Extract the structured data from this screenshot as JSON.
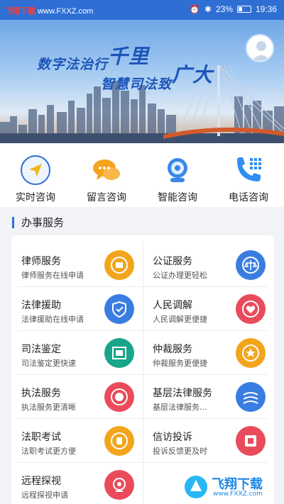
{
  "status_bar": {
    "watermark_prefix": "飞翔下载",
    "watermark_site": "www.FXXZ.com",
    "battery": "23%",
    "time": "19:36"
  },
  "banner": {
    "slogan_line1": "数字法治行",
    "slogan_line1_big": "千里",
    "slogan_line2": "智慧司法致",
    "slogan_line2_big": "广大"
  },
  "quick_actions": [
    {
      "label": "实时咨询",
      "icon": "send-icon"
    },
    {
      "label": "留言咨询",
      "icon": "chat-bubbles-icon"
    },
    {
      "label": "智能咨询",
      "icon": "robot-icon"
    },
    {
      "label": "电话咨询",
      "icon": "phone-icon"
    }
  ],
  "section": {
    "title": "办事服务"
  },
  "services": [
    {
      "title": "律师服务",
      "subtitle": "律师服务在线申请",
      "icon": "lawyer-badge-icon",
      "color": "#f2a51c"
    },
    {
      "title": "公证服务",
      "subtitle": "公证办理更轻松",
      "icon": "notary-scale-icon",
      "color": "#3a7de0"
    },
    {
      "title": "法律援助",
      "subtitle": "法律援助在线申请",
      "icon": "legal-aid-shield-icon",
      "color": "#3a7de0"
    },
    {
      "title": "人民调解",
      "subtitle": "人民调解更便捷",
      "icon": "mediation-heart-icon",
      "color": "#e94b5b"
    },
    {
      "title": "司法鉴定",
      "subtitle": "司法鉴定更快速",
      "icon": "appraisal-seal-icon",
      "color": "#18a58a"
    },
    {
      "title": "仲裁服务",
      "subtitle": "仲裁服务更便捷",
      "icon": "arbitration-emblem-icon",
      "color": "#f2a51c"
    },
    {
      "title": "执法服务",
      "subtitle": "执法服务更清晰",
      "icon": "law-enforcement-emblem-icon",
      "color": "#e94b5b"
    },
    {
      "title": "基层法律服务",
      "subtitle": "基层法律服务...",
      "icon": "grassroots-service-icon",
      "color": "#3a7de0"
    },
    {
      "title": "法职考试",
      "subtitle": "法职考试更方便",
      "icon": "exam-emblem-icon",
      "color": "#f2a51c"
    },
    {
      "title": "信访投诉",
      "subtitle": "投诉反馈更及时",
      "icon": "complaint-letter-icon",
      "color": "#e94b5b"
    },
    {
      "title": "远程探视",
      "subtitle": "远程探视申请",
      "icon": "remote-visit-camera-icon",
      "color": "#e94b5b"
    }
  ],
  "footer_watermark": {
    "brand": "飞翔下载",
    "site": "www.FXXZ.com"
  }
}
